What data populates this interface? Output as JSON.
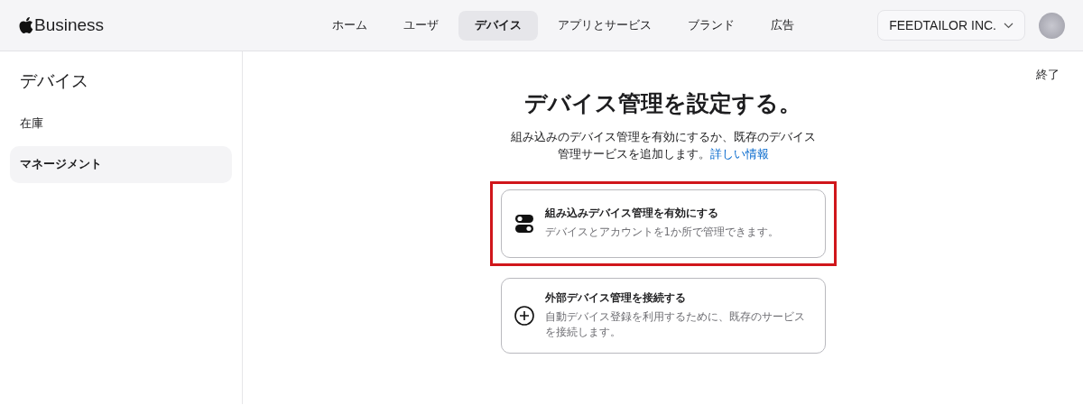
{
  "header": {
    "logo": "Business",
    "nav": [
      {
        "label": "ホーム",
        "selected": false
      },
      {
        "label": "ユーザ",
        "selected": false
      },
      {
        "label": "デバイス",
        "selected": true
      },
      {
        "label": "アプリとサービス",
        "selected": false
      },
      {
        "label": "ブランド",
        "selected": false
      },
      {
        "label": "広告",
        "selected": false
      }
    ],
    "org_menu": "FEEDTAILOR INC."
  },
  "sidebar": {
    "title": "デバイス",
    "items": [
      {
        "label": "在庫",
        "selected": false
      },
      {
        "label": "マネージメント",
        "selected": true
      }
    ]
  },
  "main": {
    "done_link": "終了",
    "title": "デバイス管理を設定する。",
    "description": "組み込みのデバイス管理を有効にするか、既存のデバイス管理サービスを追加します。",
    "learn_more_link": "詳しい情報",
    "options": [
      {
        "kind": "toggle",
        "title": "組み込みデバイス管理を有効にする",
        "description": "デバイスとアカウントを1か所で管理できます。",
        "highlighted": true
      },
      {
        "kind": "plus",
        "title": "外部デバイス管理を接続する",
        "description": "自動デバイス登録を利用するために、既存のサービスを接続します。",
        "highlighted": false
      }
    ]
  }
}
